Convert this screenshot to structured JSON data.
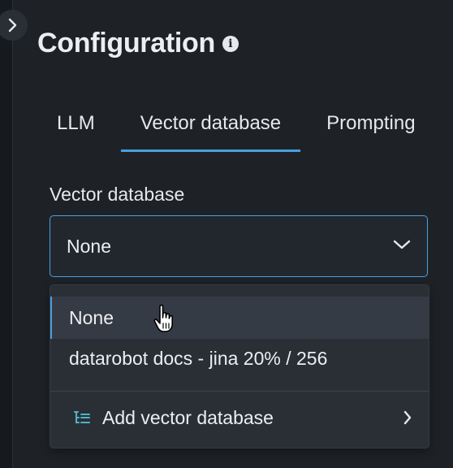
{
  "panel": {
    "title": "Configuration",
    "info_icon": "info-icon",
    "expand_icon": "chevron-right-icon"
  },
  "tabs": [
    {
      "label": "LLM",
      "active": false
    },
    {
      "label": "Vector database",
      "active": true
    },
    {
      "label": "Prompting",
      "active": false
    }
  ],
  "vector_field": {
    "label": "Vector database",
    "selected_value": "None",
    "chevron_icon": "chevron-down-icon"
  },
  "dropdown": {
    "options": [
      {
        "label": "None",
        "highlighted": true
      },
      {
        "label": "datarobot docs - jina 20% / 256",
        "highlighted": false
      }
    ],
    "add_action": {
      "label": "Add vector database",
      "icon": "list-tree-icon",
      "chevron_icon": "chevron-right-icon"
    }
  },
  "colors": {
    "background": "#1e2227",
    "accent": "#4a9fe0",
    "dropdown_bg": "#2a2f36",
    "hover_bg": "#353b44",
    "text": "#e6e8eb",
    "add_icon": "#4fb3c4"
  }
}
